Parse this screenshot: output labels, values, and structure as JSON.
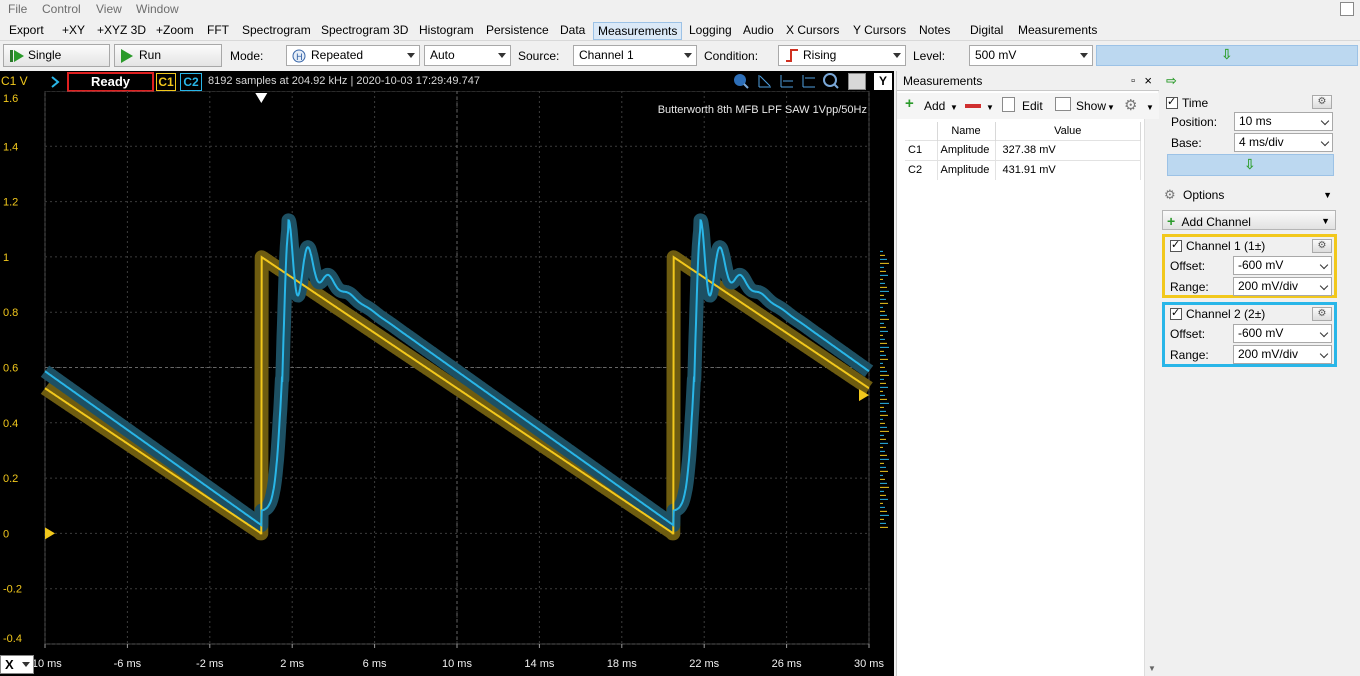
{
  "menu": [
    "File",
    "Control",
    "View",
    "Window"
  ],
  "tabs": [
    "Export",
    "+XY",
    "+XYZ 3D",
    "+Zoom",
    "FFT",
    "Spectrogram",
    "Spectrogram 3D",
    "Histogram",
    "Persistence",
    "Data",
    "Measurements",
    "Logging",
    "Audio",
    "X Cursors",
    "Y Cursors",
    "Notes",
    "Digital",
    "Measurements"
  ],
  "active_tab": "Measurements",
  "toolbar": {
    "single": "Single",
    "run": "Run",
    "mode_label": "Mode:",
    "mode": "Repeated",
    "auto": "Auto",
    "source_label": "Source:",
    "source": "Channel 1",
    "condition_label": "Condition:",
    "condition": "Rising",
    "level_label": "Level:",
    "level": "500 mV",
    "down_arrow": "⇩"
  },
  "scope": {
    "axis_name": "C1 V",
    "status": "Ready",
    "c1": "C1",
    "c2": "C2",
    "info": "8192 samples at 204.92 kHz | 2020-10-03 17:29:49.747",
    "label": "Butterworth 8th MFB LPF SAW 1Vpp/50Hz",
    "y_ticks": [
      "1.6",
      "1.4",
      "1.2",
      "1",
      "0.8",
      "0.6",
      "0.4",
      "0.2",
      "0",
      "-0.2",
      "-0.4"
    ],
    "x_ticks": [
      "-10 ms",
      "-6 ms",
      "-2 ms",
      "2 ms",
      "6 ms",
      "10 ms",
      "14 ms",
      "18 ms",
      "22 ms",
      "26 ms",
      "30 ms"
    ],
    "x_btn": "X",
    "y_btn": "Y",
    "colors": {
      "c1": "#f2c81c",
      "c2": "#29b6e8",
      "c1_glow": "#6e5c10",
      "c2_glow": "#1d5063"
    }
  },
  "measurements": {
    "title": "Measurements",
    "add": "Add",
    "edit": "Edit",
    "show": "Show",
    "columns": [
      "Name",
      "Value"
    ],
    "rows": [
      {
        "ch": "C1",
        "name": "Amplitude",
        "value": "327.38 mV"
      },
      {
        "ch": "C2",
        "name": "Amplitude",
        "value": "431.91 mV"
      }
    ]
  },
  "side": {
    "time_title": "Time",
    "position_label": "Position:",
    "position": "10 ms",
    "base_label": "Base:",
    "base": "4 ms/div",
    "options": "Options",
    "add_channel": "Add Channel",
    "ch1_title": "Channel 1 (1±)",
    "ch1_offset_label": "Offset:",
    "ch1_offset": "-600 mV",
    "ch1_range_label": "Range:",
    "ch1_range": "200 mV/div",
    "ch2_title": "Channel 2 (2±)",
    "ch2_offset_label": "Offset:",
    "ch2_offset": "-600 mV",
    "ch2_range_label": "Range:",
    "ch2_range": "200 mV/div"
  }
}
